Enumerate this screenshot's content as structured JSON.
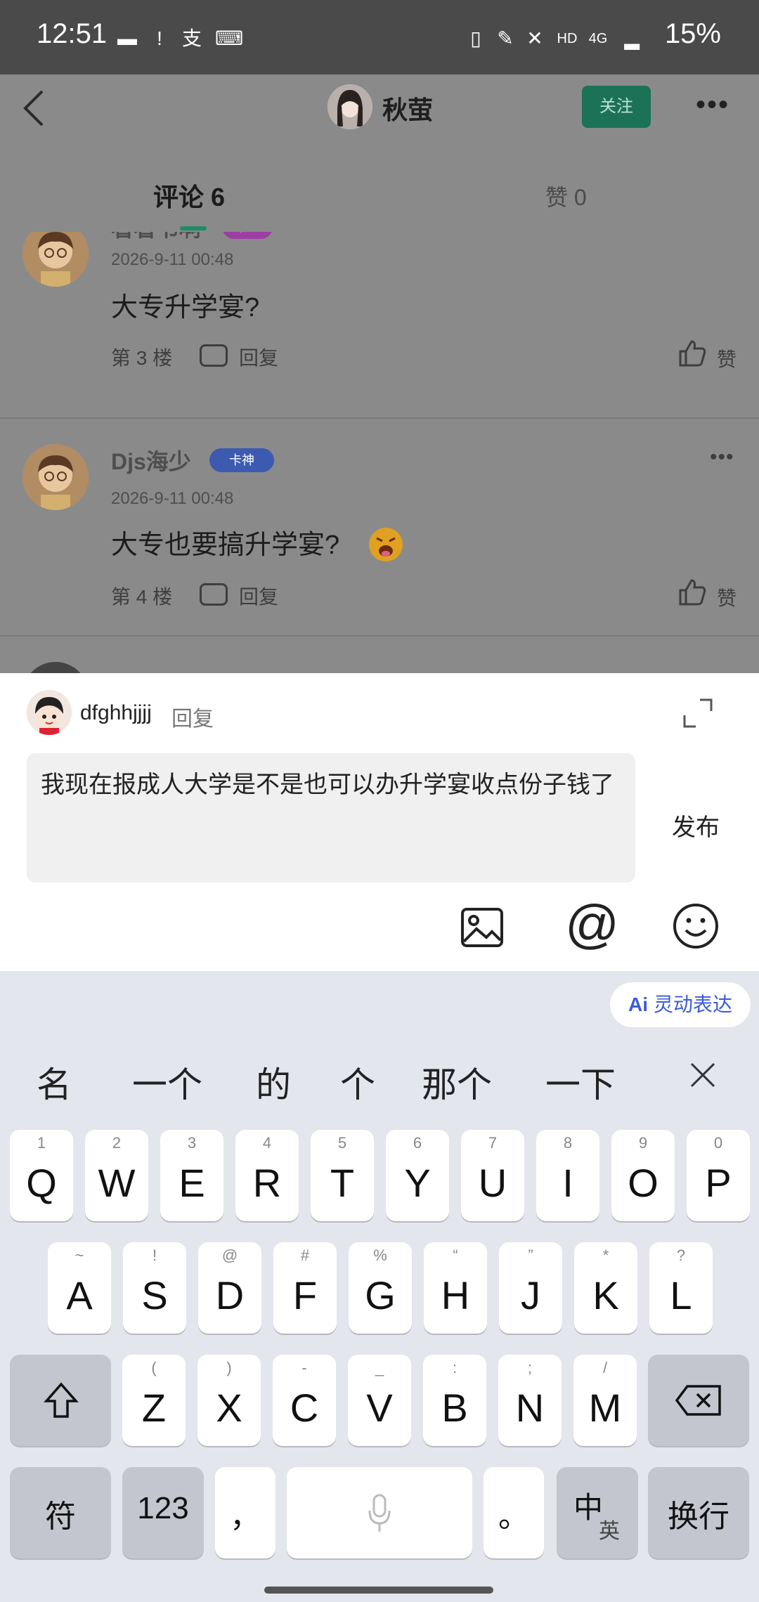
{
  "status_bar": {
    "time": "12:51",
    "battery": "15%"
  },
  "header": {
    "user_name": "秋萤",
    "follow_label": "关注",
    "tabs": [
      {
        "label": "评论 6"
      },
      {
        "label": "赞 0"
      }
    ]
  },
  "comments": [
    {
      "name": "看看书啊",
      "badge": "卡皇",
      "time": "2026-9-11 00:48",
      "text": "大专升学宴?",
      "floor": "第 3 楼",
      "reply_label": "回复",
      "like_label": "赞"
    },
    {
      "name": "Djs海少",
      "badge": "卡神",
      "time": "2026-9-11 00:48",
      "text": "大专也要搞升学宴?",
      "floor": "第 4 楼",
      "reply_label": "回复",
      "like_label": "赞"
    }
  ],
  "reply_sheet": {
    "user_name": "dfghhjjjj",
    "reply_label": "回复",
    "input_text": "我现在报成人大学是不是也可以办升学宴收点份子钱了",
    "publish_label": "发布"
  },
  "keyboard": {
    "ai_chip": "灵动表达",
    "candidates": [
      "名",
      "一个",
      "的",
      "个",
      "那个",
      "一下"
    ],
    "row1": [
      {
        "key": "Q",
        "sup": "1"
      },
      {
        "key": "W",
        "sup": "2"
      },
      {
        "key": "E",
        "sup": "3"
      },
      {
        "key": "R",
        "sup": "4"
      },
      {
        "key": "T",
        "sup": "5"
      },
      {
        "key": "Y",
        "sup": "6"
      },
      {
        "key": "U",
        "sup": "7"
      },
      {
        "key": "I",
        "sup": "8"
      },
      {
        "key": "O",
        "sup": "9"
      },
      {
        "key": "P",
        "sup": "0"
      }
    ],
    "row2": [
      {
        "key": "A",
        "sup": "~"
      },
      {
        "key": "S",
        "sup": "!"
      },
      {
        "key": "D",
        "sup": "@"
      },
      {
        "key": "F",
        "sup": "#"
      },
      {
        "key": "G",
        "sup": "%"
      },
      {
        "key": "H",
        "sup": "“"
      },
      {
        "key": "J",
        "sup": "”"
      },
      {
        "key": "K",
        "sup": "*"
      },
      {
        "key": "L",
        "sup": "?"
      }
    ],
    "row3": [
      {
        "key": "Z",
        "sup": "("
      },
      {
        "key": "X",
        "sup": ")"
      },
      {
        "key": "C",
        "sup": "-"
      },
      {
        "key": "V",
        "sup": "_"
      },
      {
        "key": "B",
        "sup": ":"
      },
      {
        "key": "N",
        "sup": ";"
      },
      {
        "key": "M",
        "sup": "/"
      }
    ],
    "bottom": {
      "symbols": "符",
      "numbers": "123",
      "comma": "，",
      "period": "。",
      "lang_main": "中",
      "lang_sub": "英",
      "enter": "换行"
    }
  }
}
